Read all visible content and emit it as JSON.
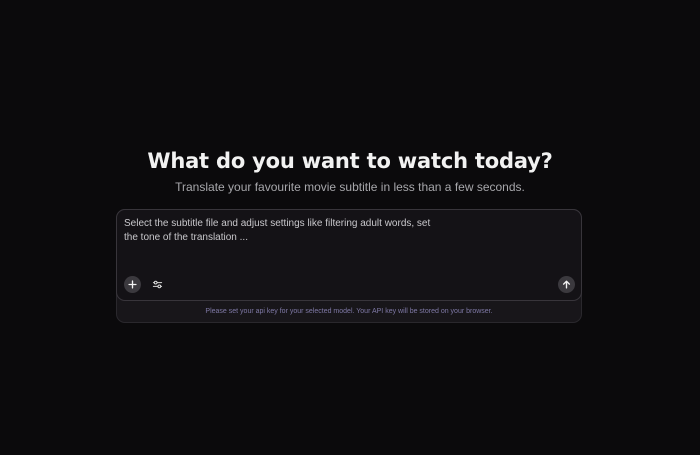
{
  "hero": {
    "title": "What do you want to watch today?",
    "subtitle": "Translate your favourite movie subtitle in less than a few seconds."
  },
  "composer": {
    "prompt_placeholder": "Select the subtitle file and adjust settings like filtering adult words, set the tone of the translation ...",
    "add_icon": "plus-icon",
    "settings_icon": "sliders-icon",
    "send_icon": "arrow-up-icon",
    "notice": "Please set your api key for your selected model. Your API key will be stored on your browser."
  },
  "colors": {
    "background": "#0b0a0c",
    "card": "#141216",
    "notice_text": "#7f79a6"
  }
}
